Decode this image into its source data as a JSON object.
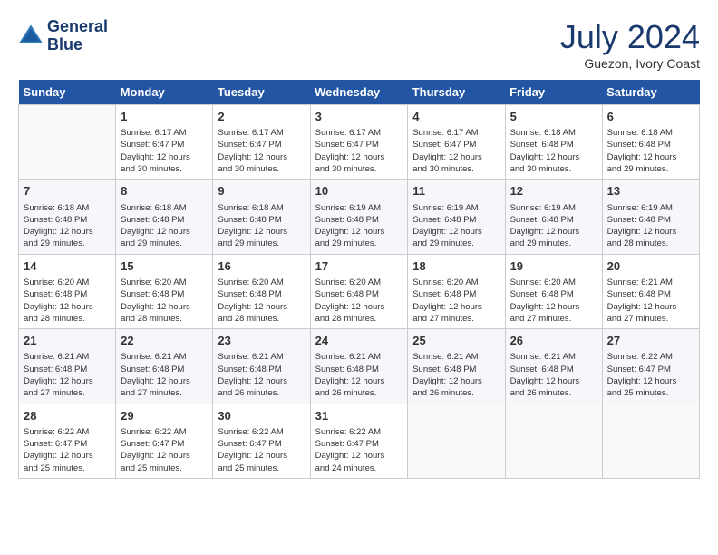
{
  "header": {
    "logo_line1": "General",
    "logo_line2": "Blue",
    "month_year": "July 2024",
    "location": "Guezon, Ivory Coast"
  },
  "days_of_week": [
    "Sunday",
    "Monday",
    "Tuesday",
    "Wednesday",
    "Thursday",
    "Friday",
    "Saturday"
  ],
  "weeks": [
    [
      {
        "day": "",
        "info": ""
      },
      {
        "day": "1",
        "info": "Sunrise: 6:17 AM\nSunset: 6:47 PM\nDaylight: 12 hours\nand 30 minutes."
      },
      {
        "day": "2",
        "info": "Sunrise: 6:17 AM\nSunset: 6:47 PM\nDaylight: 12 hours\nand 30 minutes."
      },
      {
        "day": "3",
        "info": "Sunrise: 6:17 AM\nSunset: 6:47 PM\nDaylight: 12 hours\nand 30 minutes."
      },
      {
        "day": "4",
        "info": "Sunrise: 6:17 AM\nSunset: 6:47 PM\nDaylight: 12 hours\nand 30 minutes."
      },
      {
        "day": "5",
        "info": "Sunrise: 6:18 AM\nSunset: 6:48 PM\nDaylight: 12 hours\nand 30 minutes."
      },
      {
        "day": "6",
        "info": "Sunrise: 6:18 AM\nSunset: 6:48 PM\nDaylight: 12 hours\nand 29 minutes."
      }
    ],
    [
      {
        "day": "7",
        "info": "Sunrise: 6:18 AM\nSunset: 6:48 PM\nDaylight: 12 hours\nand 29 minutes."
      },
      {
        "day": "8",
        "info": "Sunrise: 6:18 AM\nSunset: 6:48 PM\nDaylight: 12 hours\nand 29 minutes."
      },
      {
        "day": "9",
        "info": "Sunrise: 6:18 AM\nSunset: 6:48 PM\nDaylight: 12 hours\nand 29 minutes."
      },
      {
        "day": "10",
        "info": "Sunrise: 6:19 AM\nSunset: 6:48 PM\nDaylight: 12 hours\nand 29 minutes."
      },
      {
        "day": "11",
        "info": "Sunrise: 6:19 AM\nSunset: 6:48 PM\nDaylight: 12 hours\nand 29 minutes."
      },
      {
        "day": "12",
        "info": "Sunrise: 6:19 AM\nSunset: 6:48 PM\nDaylight: 12 hours\nand 29 minutes."
      },
      {
        "day": "13",
        "info": "Sunrise: 6:19 AM\nSunset: 6:48 PM\nDaylight: 12 hours\nand 28 minutes."
      }
    ],
    [
      {
        "day": "14",
        "info": "Sunrise: 6:20 AM\nSunset: 6:48 PM\nDaylight: 12 hours\nand 28 minutes."
      },
      {
        "day": "15",
        "info": "Sunrise: 6:20 AM\nSunset: 6:48 PM\nDaylight: 12 hours\nand 28 minutes."
      },
      {
        "day": "16",
        "info": "Sunrise: 6:20 AM\nSunset: 6:48 PM\nDaylight: 12 hours\nand 28 minutes."
      },
      {
        "day": "17",
        "info": "Sunrise: 6:20 AM\nSunset: 6:48 PM\nDaylight: 12 hours\nand 28 minutes."
      },
      {
        "day": "18",
        "info": "Sunrise: 6:20 AM\nSunset: 6:48 PM\nDaylight: 12 hours\nand 27 minutes."
      },
      {
        "day": "19",
        "info": "Sunrise: 6:20 AM\nSunset: 6:48 PM\nDaylight: 12 hours\nand 27 minutes."
      },
      {
        "day": "20",
        "info": "Sunrise: 6:21 AM\nSunset: 6:48 PM\nDaylight: 12 hours\nand 27 minutes."
      }
    ],
    [
      {
        "day": "21",
        "info": "Sunrise: 6:21 AM\nSunset: 6:48 PM\nDaylight: 12 hours\nand 27 minutes."
      },
      {
        "day": "22",
        "info": "Sunrise: 6:21 AM\nSunset: 6:48 PM\nDaylight: 12 hours\nand 27 minutes."
      },
      {
        "day": "23",
        "info": "Sunrise: 6:21 AM\nSunset: 6:48 PM\nDaylight: 12 hours\nand 26 minutes."
      },
      {
        "day": "24",
        "info": "Sunrise: 6:21 AM\nSunset: 6:48 PM\nDaylight: 12 hours\nand 26 minutes."
      },
      {
        "day": "25",
        "info": "Sunrise: 6:21 AM\nSunset: 6:48 PM\nDaylight: 12 hours\nand 26 minutes."
      },
      {
        "day": "26",
        "info": "Sunrise: 6:21 AM\nSunset: 6:48 PM\nDaylight: 12 hours\nand 26 minutes."
      },
      {
        "day": "27",
        "info": "Sunrise: 6:22 AM\nSunset: 6:47 PM\nDaylight: 12 hours\nand 25 minutes."
      }
    ],
    [
      {
        "day": "28",
        "info": "Sunrise: 6:22 AM\nSunset: 6:47 PM\nDaylight: 12 hours\nand 25 minutes."
      },
      {
        "day": "29",
        "info": "Sunrise: 6:22 AM\nSunset: 6:47 PM\nDaylight: 12 hours\nand 25 minutes."
      },
      {
        "day": "30",
        "info": "Sunrise: 6:22 AM\nSunset: 6:47 PM\nDaylight: 12 hours\nand 25 minutes."
      },
      {
        "day": "31",
        "info": "Sunrise: 6:22 AM\nSunset: 6:47 PM\nDaylight: 12 hours\nand 24 minutes."
      },
      {
        "day": "",
        "info": ""
      },
      {
        "day": "",
        "info": ""
      },
      {
        "day": "",
        "info": ""
      }
    ]
  ]
}
